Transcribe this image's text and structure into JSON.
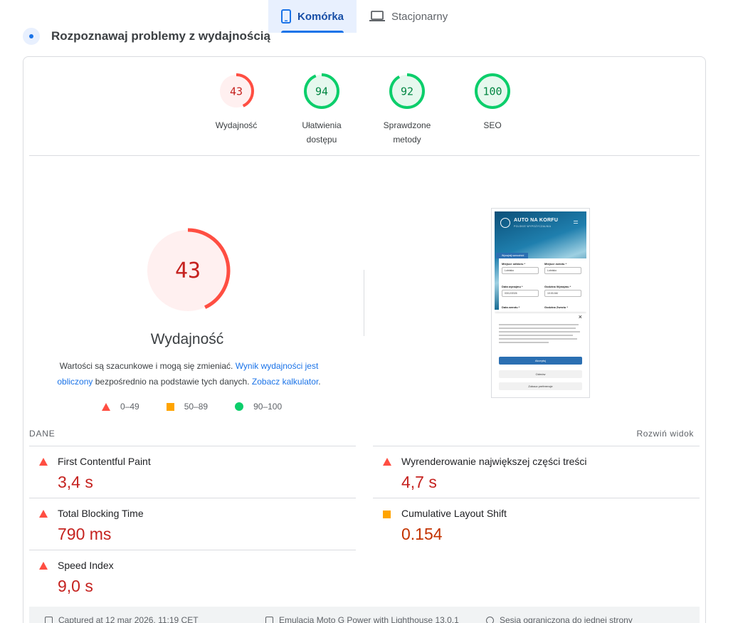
{
  "device_tabs": [
    {
      "label": "Komórka",
      "icon": "smartphone-icon",
      "active": true
    },
    {
      "label": "Stacjonarny",
      "icon": "laptop-icon",
      "active": false
    }
  ],
  "section": {
    "title": "Rozpoznawaj problemy z wydajnością"
  },
  "gauges": [
    {
      "score": "43",
      "label": "Wydajność",
      "status": "poor",
      "fraction": 0.43,
      "color": "#ff4e42",
      "fill": "#fff0f0",
      "text_color": "#c5221f"
    },
    {
      "score": "94",
      "label": "Ułatwienia dostępu",
      "status": "good",
      "fraction": 0.94,
      "color": "#0cce6b",
      "fill": "#e6f8ee",
      "text_color": "#018642"
    },
    {
      "score": "92",
      "label": "Sprawdzone metody",
      "status": "good",
      "fraction": 0.92,
      "color": "#0cce6b",
      "fill": "#e6f8ee",
      "text_color": "#018642"
    },
    {
      "score": "100",
      "label": "SEO",
      "status": "good",
      "fraction": 1.0,
      "color": "#0cce6b",
      "fill": "#e6f8ee",
      "text_color": "#018642"
    }
  ],
  "main_gauge": {
    "score": "43",
    "fraction": 0.43,
    "title": "Wydajność",
    "desc_before": "Wartości są szacunkowe i mogą się zmieniać. ",
    "desc_link1": "Wynik wydajności jest obliczony",
    "desc_middle": " bezpośrednio na podstawie tych danych. ",
    "desc_link2": "Zobacz kalkulator",
    "desc_after": "."
  },
  "legend": [
    {
      "shape": "triangle",
      "range": "0–49",
      "color": "#ff4e42"
    },
    {
      "shape": "square",
      "range": "50–89",
      "color": "#ffa400"
    },
    {
      "shape": "circle",
      "range": "90–100",
      "color": "#0cce6b"
    }
  ],
  "thumbnail": {
    "logo": "AUTO NA KORFU",
    "logo_sub": "POLSKIE WYPOŻYCZALNIA",
    "tab": "Wynajmij samochód",
    "pickup_label": "Miejsce odbioru *",
    "return_label": "Miejsce zwrotu *",
    "pickup_value": "Lotnisko",
    "return_value": "Lotnisko",
    "date_label": "Data wynajmu *",
    "date_value": "03/12/2026",
    "time_label": "Godzina Wynajmu *",
    "time_value": "10:00 AM",
    "return_date_label": "Data zwrotu *",
    "return_time_label": "Godzina Zwrotu *",
    "accept": "Akceptuj",
    "reject": "Odmów",
    "prefs": "Zobacz preferencje"
  },
  "metrics": {
    "section_label": "DANE",
    "expand": "Rozwiń widok",
    "left": [
      {
        "title": "First Contentful Paint",
        "value": "3,4 s",
        "status": "poor"
      },
      {
        "title": "Total Blocking Time",
        "value": "790 ms",
        "status": "poor"
      },
      {
        "title": "Speed Index",
        "value": "9,0 s",
        "status": "poor"
      }
    ],
    "right": [
      {
        "title": "Wyrenderowanie największej części treści",
        "value": "4,7 s",
        "status": "poor"
      },
      {
        "title": "Cumulative Layout Shift",
        "value": "0.154",
        "status": "average"
      }
    ]
  },
  "footer": [
    {
      "icon": "calendar-icon",
      "text": "Captured at 12 mar 2026, 11:19 CET"
    },
    {
      "icon": "device-icon",
      "text": "Emulacja Moto G Power with Lighthouse 13.0.1"
    },
    {
      "icon": "person-icon",
      "text": "Sesja ograniczona do jednej strony"
    }
  ]
}
